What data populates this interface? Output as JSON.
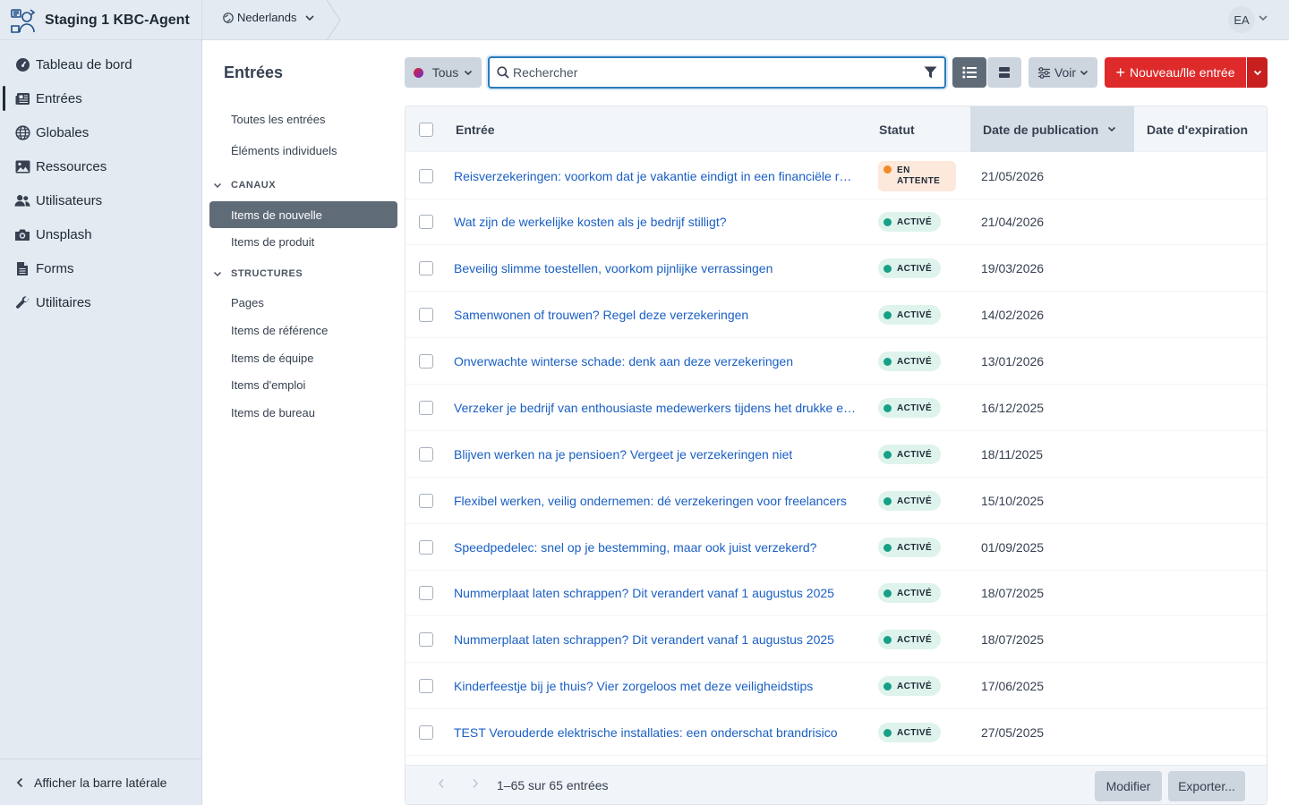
{
  "app": {
    "title": "Staging 1 KBC-Agent",
    "language": "Nederlands",
    "user_initials": "EA"
  },
  "sidebar": {
    "items": [
      {
        "label": "Tableau de bord",
        "icon": "dashboard-icon"
      },
      {
        "label": "Entrées",
        "icon": "newspaper-icon",
        "active": true
      },
      {
        "label": "Globales",
        "icon": "globe-icon"
      },
      {
        "label": "Ressources",
        "icon": "image-icon"
      },
      {
        "label": "Utilisateurs",
        "icon": "users-icon"
      },
      {
        "label": "Unsplash",
        "icon": "camera-icon"
      },
      {
        "label": "Forms",
        "icon": "document-icon"
      },
      {
        "label": "Utilitaires",
        "icon": "wrench-icon"
      }
    ],
    "collapse_label": "Afficher la barre latérale"
  },
  "subnav": {
    "title": "Entrées",
    "top_items": [
      "Toutes les entrées",
      "Éléments individuels"
    ],
    "channels_heading": "CANAUX",
    "channels": [
      "Items de nouvelle",
      "Items de produit"
    ],
    "selected": "Items de nouvelle",
    "structures_heading": "STRUCTURES",
    "structures": [
      "Pages",
      "Items de référence",
      "Items de équipe",
      "Items d'emploi",
      "Items de bureau"
    ]
  },
  "toolbar": {
    "site_label": "Tous",
    "search_placeholder": "Rechercher",
    "voir_label": "Voir",
    "new_label": "Nouveau/lle entrée"
  },
  "table": {
    "columns": {
      "entry": "Entrée",
      "status": "Statut",
      "published": "Date de publication",
      "expires": "Date d'expiration"
    },
    "rows": [
      {
        "title": "Reisverzekeringen: voorkom dat je vakantie eindigt in een financiële ramp",
        "status": "EN ATTENTE",
        "status_line1": "EN",
        "status_line2": "ATTENTE",
        "pending": true,
        "date": "21/05/2026"
      },
      {
        "title": "Wat zijn de werkelijke kosten als je bedrijf stilligt?",
        "status": "ACTIVÉ",
        "date": "21/04/2026"
      },
      {
        "title": "Beveilig slimme toestellen, voorkom pijnlijke verrassingen",
        "status": "ACTIVÉ",
        "date": "19/03/2026"
      },
      {
        "title": "Samenwonen of trouwen? Regel deze verzekeringen",
        "status": "ACTIVÉ",
        "date": "14/02/2026"
      },
      {
        "title": "Onverwachte winterse schade: denk aan deze verzekeringen",
        "status": "ACTIVÉ",
        "date": "13/01/2026"
      },
      {
        "title": "Verzeker je bedrijf van enthousiaste medewerkers tijdens het drukke eindejaar",
        "status": "ACTIVÉ",
        "date": "16/12/2025"
      },
      {
        "title": "Blijven werken na je pensioen? Vergeet je verzekeringen niet",
        "status": "ACTIVÉ",
        "date": "18/11/2025"
      },
      {
        "title": "Flexibel werken, veilig ondernemen: dé verzekeringen voor freelancers",
        "status": "ACTIVÉ",
        "date": "15/10/2025"
      },
      {
        "title": "Speedpedelec: snel op je bestemming, maar ook juist verzekerd?",
        "status": "ACTIVÉ",
        "date": "01/09/2025"
      },
      {
        "title": "Nummerplaat laten schrappen? Dit verandert vanaf 1 augustus 2025",
        "status": "ACTIVÉ",
        "date": "18/07/2025"
      },
      {
        "title": "Nummerplaat laten schrappen? Dit verandert vanaf 1 augustus 2025",
        "status": "ACTIVÉ",
        "date": "18/07/2025"
      },
      {
        "title": "Kinderfeestje bij je thuis? Vier zorgeloos met deze veiligheidstips",
        "status": "ACTIVÉ",
        "date": "17/06/2025"
      },
      {
        "title": "TEST Verouderde elektrische installaties: een onderschat brandrisico",
        "status": "ACTIVÉ",
        "date": "27/05/2025"
      }
    ]
  },
  "footer": {
    "count": "1–65 sur 65 entrées",
    "edit_label": "Modifier",
    "export_label": "Exporter..."
  },
  "colors": {
    "primary_red": "#de2a2a",
    "link_blue": "#1a5fc4",
    "active_green": "#16a085",
    "pending_orange": "#f28a25"
  }
}
